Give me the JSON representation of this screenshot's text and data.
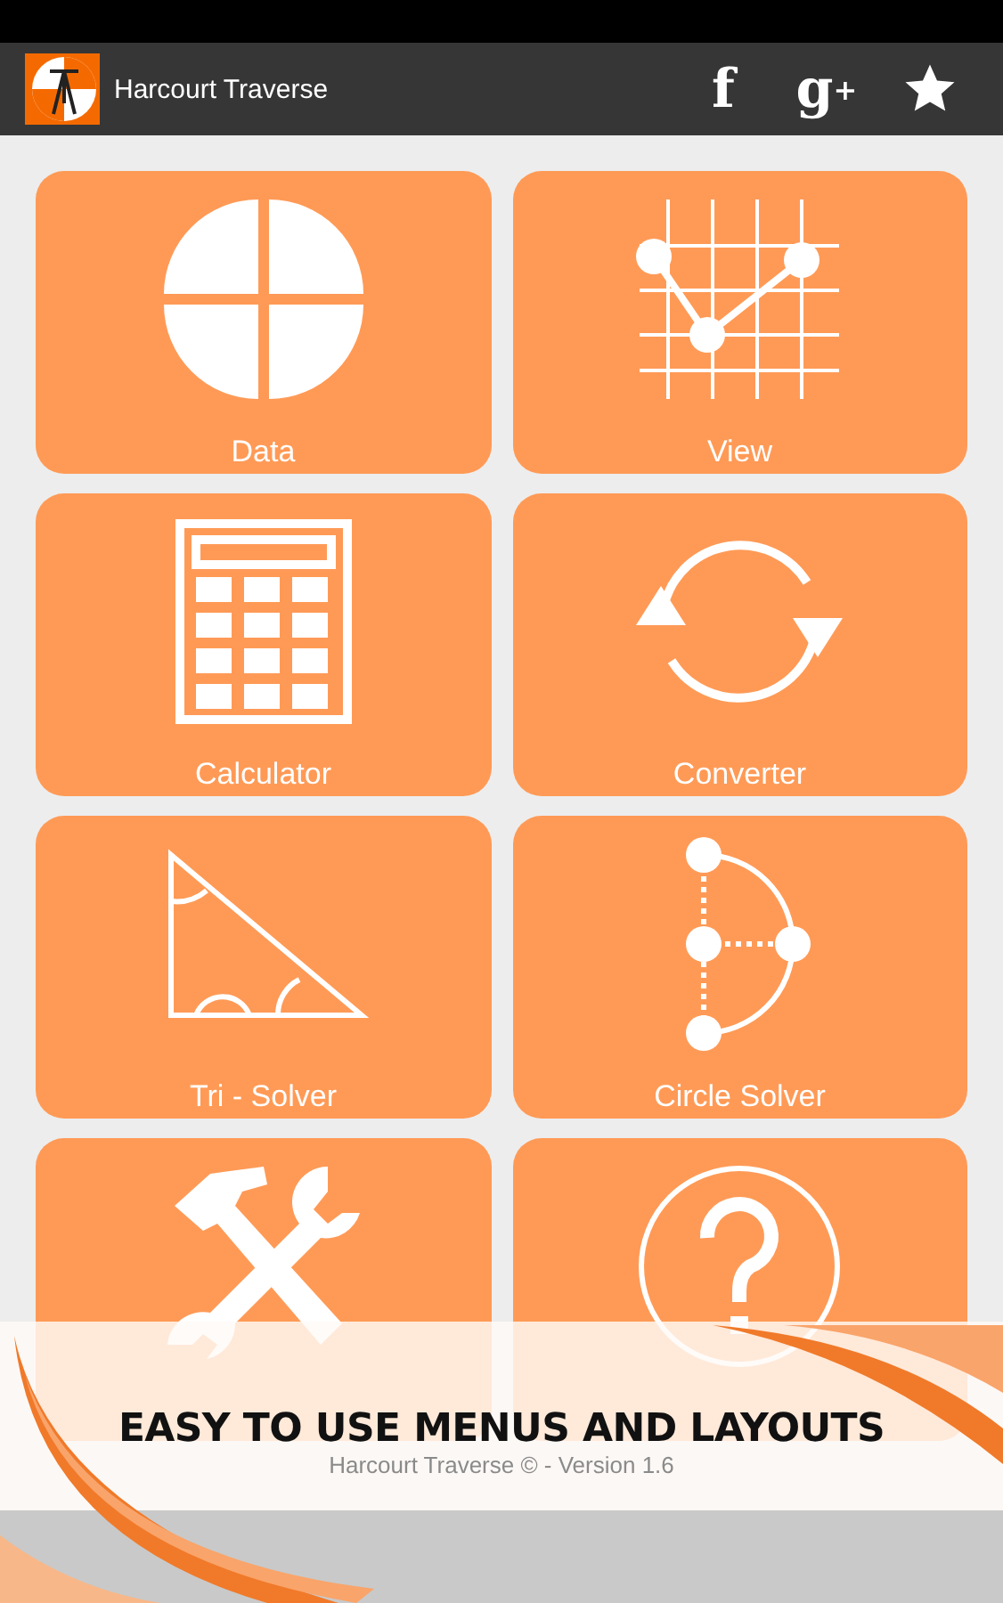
{
  "app_bar": {
    "title": "Harcourt Traverse",
    "actions": [
      {
        "kind": "text",
        "label": "f"
      },
      {
        "kind": "text",
        "label": "g$^{+}$"
      },
      {
        "kind": "star"
      }
    ]
  },
  "tiles": [
    {
      "kind": "pie",
      "label": "Data"
    },
    {
      "kind": "graph",
      "label": "View"
    },
    {
      "kind": "calculator",
      "label": "Calculator"
    },
    {
      "kind": "cycle",
      "label": "Converter"
    },
    {
      "kind": "triangle",
      "label": "Tri - Solver"
    },
    {
      "kind": "circle",
      "label": "Circle Solver"
    },
    {
      "kind": "tools"
    },
    {
      "kind": "help"
    }
  ],
  "footer": "Harcourt Traverse © - Version 1.6",
  "banner": {
    "headline": "EASY TO USE MENUS AND LAYOUTS"
  }
}
